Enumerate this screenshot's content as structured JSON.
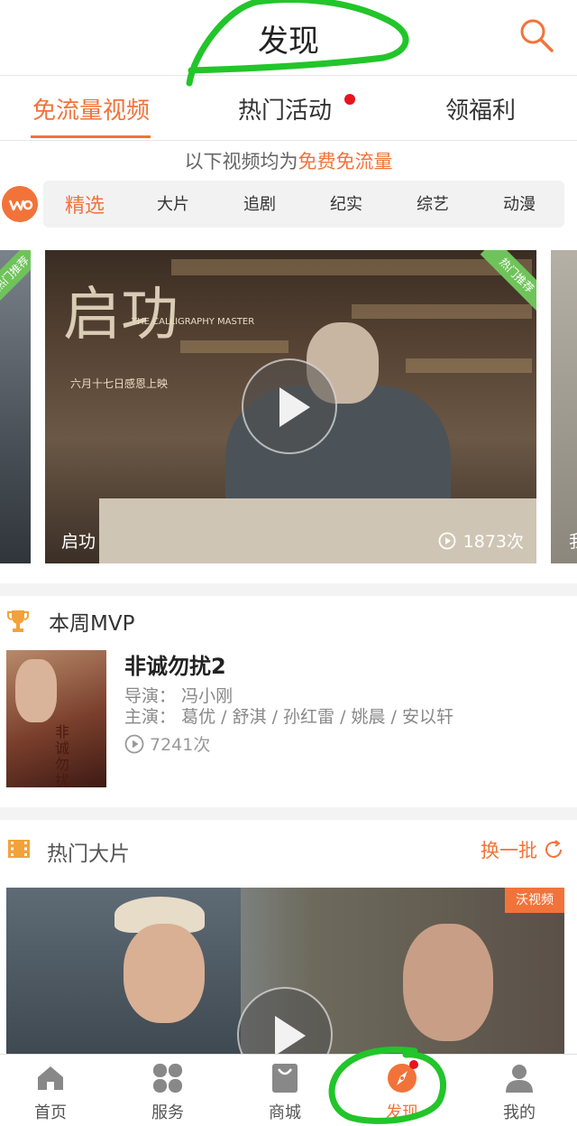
{
  "header": {
    "title": "发现"
  },
  "tabs": [
    {
      "label": "免流量视频",
      "active": true
    },
    {
      "label": "热门活动",
      "dot": true
    },
    {
      "label": "领福利"
    }
  ],
  "notice": {
    "prefix": "以下视频均为",
    "highlight": "免费免流量"
  },
  "categories": [
    "精选",
    "大片",
    "追剧",
    "纪实",
    "综艺",
    "动漫"
  ],
  "carousel": {
    "main": {
      "caption": "启功",
      "views": "1873次",
      "badge": "热门推荐",
      "art_title": "启功",
      "art_en": "THE CALLIGRAPHY MASTER",
      "art_sub": "六月十七日感恩上映"
    },
    "left_badge": "热门推荐",
    "right_caption": "我"
  },
  "mvp": {
    "heading": "本周MVP",
    "title": "非诚勿扰2",
    "director_label": "导演：",
    "director": "冯小刚",
    "cast_label": "主演：",
    "cast": "葛优 / 舒淇 / 孙红雷 / 姚晨 / 安以轩",
    "views": "7241次",
    "poster_text": "非诚勿扰II"
  },
  "hot": {
    "heading": "热门大片",
    "refresh_label": "换一批",
    "badge": "沃视频"
  },
  "bottom_nav": [
    {
      "label": "首页",
      "icon": "home-icon"
    },
    {
      "label": "服务",
      "icon": "grid-icon"
    },
    {
      "label": "商城",
      "icon": "shopping-bag-icon"
    },
    {
      "label": "发现",
      "icon": "compass-icon",
      "active": true,
      "dot": true
    },
    {
      "label": "我的",
      "icon": "user-icon"
    }
  ],
  "colors": {
    "accent": "#f2733a",
    "dot": "#e8131f",
    "annotation": "#22c52a"
  }
}
